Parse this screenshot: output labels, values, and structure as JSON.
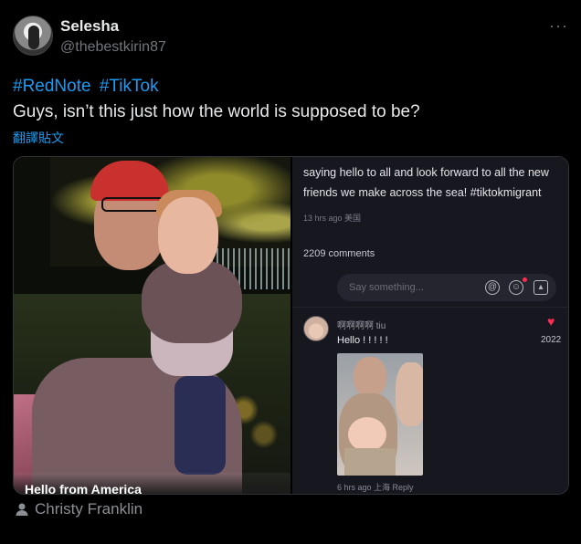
{
  "author": {
    "name": "Selesha",
    "handle": "@thebestkirin87"
  },
  "tweet": {
    "hashtags": [
      "#RedNote",
      "#TikTok"
    ],
    "text": "Guys, isn’t this just how the world is supposed to be?",
    "translate_label": "翻譯貼文"
  },
  "media": {
    "photo_caption": "Hello from America",
    "post_body": "saying hello to all and look forward to all the new friends we make across the sea!  #tiktokmigrant",
    "post_meta": "13 hrs ago 美国",
    "comment_count": "2209 comments",
    "comment_input_placeholder": "Say something...",
    "comment": {
      "username": "啊啊啊啊 tiu",
      "text": "Hello ! ! ! ! !",
      "likes": "2022",
      "meta": "6 hrs ago 上海 Reply"
    }
  },
  "attribution": "Christy Franklin",
  "colors": {
    "accent": "#1d9bf0",
    "heart": "#ff2d55",
    "background": "#000000"
  }
}
